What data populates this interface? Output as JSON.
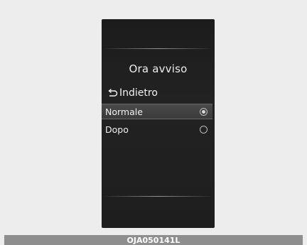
{
  "screen": {
    "title": "Ora avviso",
    "back_label": "Indietro",
    "back_icon": "return-arrow-icon",
    "options": [
      {
        "label": "Normale",
        "selected": true
      },
      {
        "label": "Dopo",
        "selected": false
      }
    ]
  },
  "caption": "OJA050141L",
  "colors": {
    "page_background": "#ededed",
    "screen_background": "#1e1e1e",
    "highlight": "#424242",
    "caption_bar": "#8e8e8e"
  }
}
